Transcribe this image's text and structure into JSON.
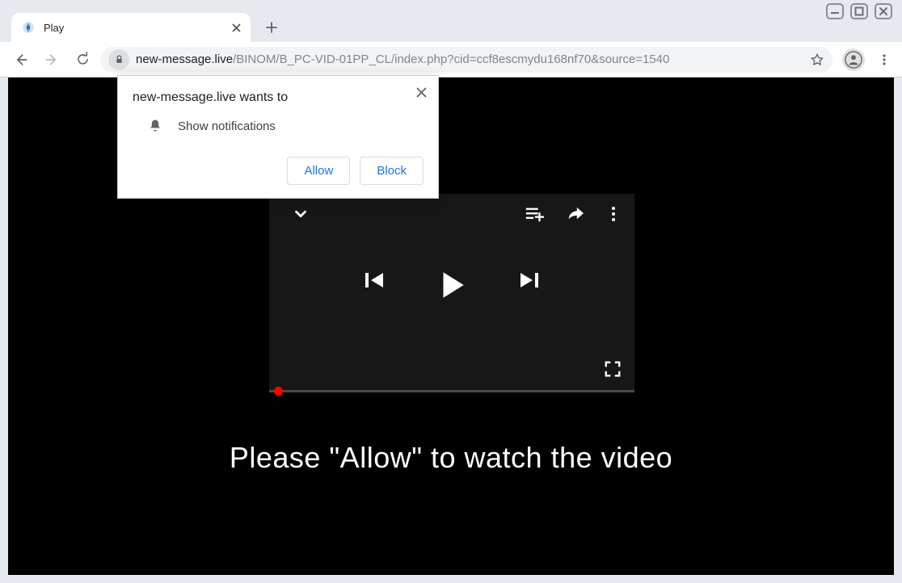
{
  "window_controls": {
    "min": "–",
    "max": "▢",
    "close": "✕"
  },
  "tab": {
    "title": "Play"
  },
  "url": {
    "host": "new-message.live",
    "path": "/BINOM/B_PC-VID-01PP_CL/index.php?cid=ccf8escmydu168nf70&source=1540"
  },
  "permission": {
    "title": "new-message.live wants to",
    "item": "Show notifications",
    "allow": "Allow",
    "block": "Block"
  },
  "page": {
    "cta": "Please \"Allow\" to watch the video"
  }
}
